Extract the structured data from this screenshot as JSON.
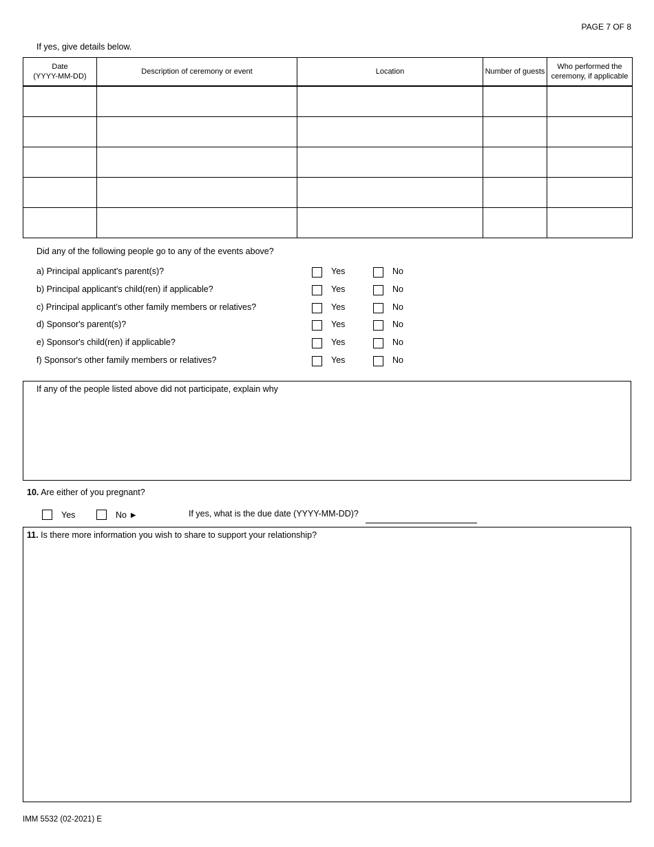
{
  "page_label": "PAGE 7 OF 8",
  "intro": "If yes, give details below.",
  "events_table": {
    "headers": [
      "Date\n(YYYY-MM-DD)",
      "Description of ceremony or event",
      "Location",
      "Number of guests",
      "Who performed the ceremony, if applicable"
    ],
    "rows": [
      [
        "",
        "",
        "",
        "",
        ""
      ],
      [
        "",
        "",
        "",
        "",
        ""
      ],
      [
        "",
        "",
        "",
        "",
        ""
      ],
      [
        "",
        "",
        "",
        "",
        ""
      ],
      [
        "",
        "",
        "",
        "",
        ""
      ]
    ]
  },
  "attendance": {
    "question": "Did any of the following people go to any of the events above?",
    "yes_label": "Yes",
    "no_label": "No",
    "items": [
      {
        "label": "a) Principal applicant's parent(s)?"
      },
      {
        "label": "b) Principal applicant's child(ren) if applicable?"
      },
      {
        "label": "c) Principal applicant's other family members or relatives?"
      },
      {
        "label": "d) Sponsor's parent(s)?"
      },
      {
        "label": "e) Sponsor's child(ren) if applicable?"
      },
      {
        "label": "f) Sponsor's other family members or relatives?"
      }
    ]
  },
  "explain": {
    "label": "If any of the people listed above did not participate, explain why",
    "value": ""
  },
  "q10": {
    "number": "10.",
    "label": "Are either of you pregnant?",
    "yes_label": "Yes",
    "no_label": "No ►",
    "due_date_label": "If yes, what is the due date (YYYY-MM-DD)?",
    "due_date_value": ""
  },
  "q11": {
    "number": "11.",
    "label": "Is there more information you wish to share to support your relationship?",
    "value": ""
  },
  "footer": "IMM 5532 (02-2021) E"
}
